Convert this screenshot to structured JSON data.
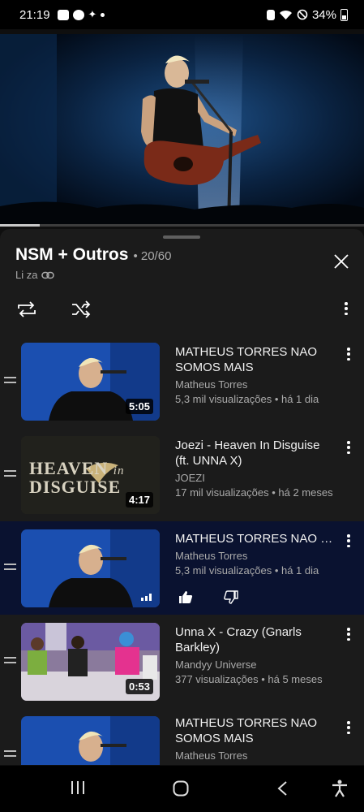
{
  "status": {
    "time": "21:19",
    "battery": "34%",
    "icons_left": [
      "gallery-icon",
      "whatsapp-icon",
      "butterfly-icon",
      "dot-icon"
    ],
    "icons_right": [
      "alarm-icon",
      "wifi-icon",
      "dnd-icon",
      "battery-icon"
    ]
  },
  "player": {
    "progress_fraction": 0.11,
    "accent": "#c8c8c8"
  },
  "playlist": {
    "title": "NSM + Outros",
    "separator": "•",
    "count": "20/60",
    "owner": "Li za",
    "owner_icon": "link-icon"
  },
  "items": [
    {
      "title": "MATHEUS TORRES NAO SOMOS MAIS",
      "channel": "Matheus Torres",
      "meta": "5,3 mil visualizações • há 1 dia",
      "duration": "5:05"
    },
    {
      "title": "Joezi - Heaven In Disguise (ft. UNNA X)",
      "channel": "JOEZI",
      "meta": "17 mil visualizações • há 2 meses",
      "duration": "4:17",
      "thumb_text_line1": "HEAVEN",
      "thumb_text_line2": "DISGUISE",
      "thumb_text_in": "in"
    },
    {
      "title": "MATHEUS TORRES NAO SOMOS MAIS",
      "channel": "Matheus Torres",
      "meta": "5,3 mil visualizações • há 1 dia",
      "active": true
    },
    {
      "title": "Unna X - Crazy (Gnarls Barkley)",
      "channel": "Mandyy Universe",
      "meta": "377 visualizações • há 5 meses",
      "duration": "0:53"
    },
    {
      "title": "MATHEUS TORRES NAO SOMOS MAIS",
      "channel": "Matheus Torres"
    }
  ],
  "colors": {
    "active_row": "#0a1230",
    "sheet_bg": "#1b1b1b",
    "secondary_text": "#aaaaaa"
  }
}
